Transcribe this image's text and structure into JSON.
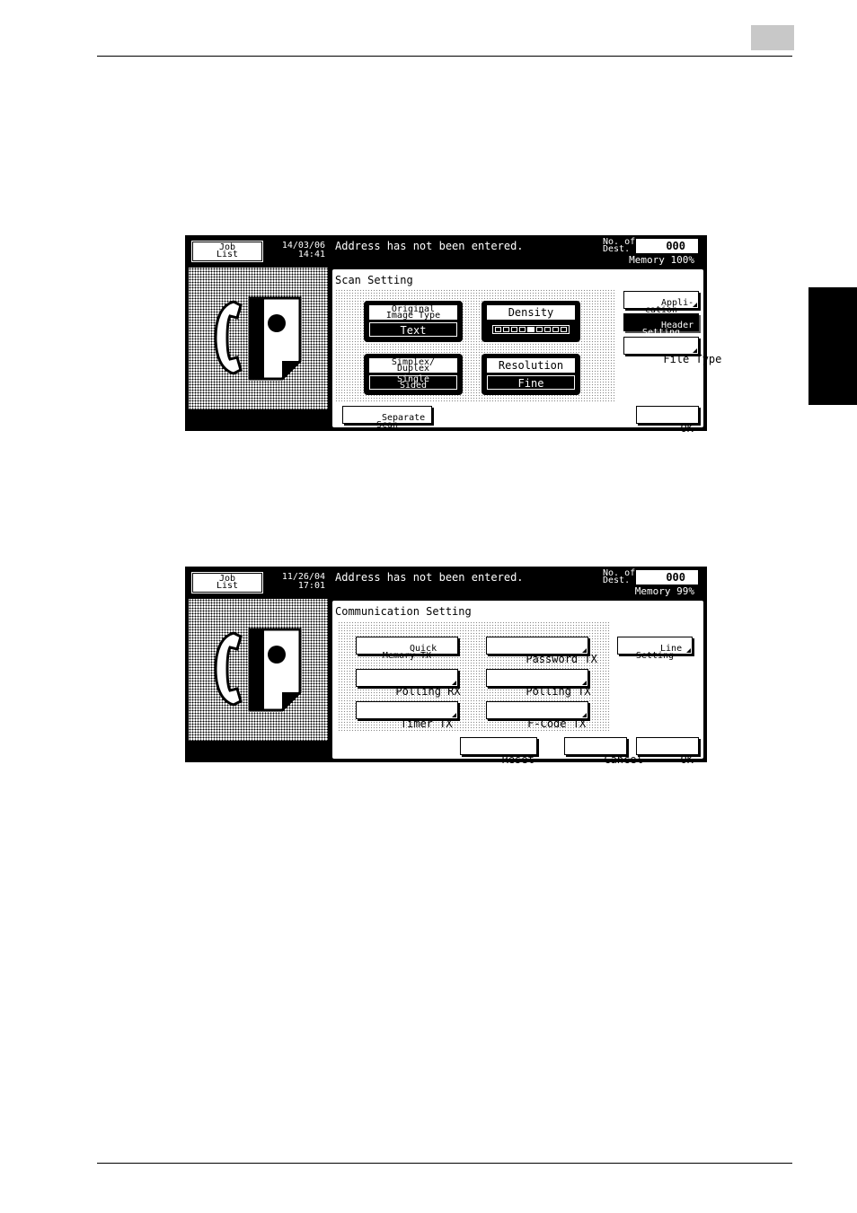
{
  "screen1": {
    "job_list_label": "Job\nList",
    "datetime": "14/03/06\n14:41",
    "message": "Address has not been entered.",
    "dest_label": "No. of\nDest.",
    "dest_count": "000",
    "memory": "Memory 100%",
    "panel_title": "Scan Setting",
    "original_image_type_label": "Original\nImage Type",
    "original_image_type_value": "Text",
    "density_label": "Density",
    "density_level": 0.5,
    "simplex_duplex_label": "Simplex/\nDuplex",
    "simplex_duplex_value": "Single\nSided",
    "resolution_label": "Resolution",
    "resolution_value": "Fine",
    "application_label": "Appli-\ncation",
    "header_setting_label": "Header\nSetting",
    "file_type_label": "File Type",
    "separate_scan_label": "Separate\nScan",
    "ok_label": "OK"
  },
  "screen2": {
    "job_list_label": "Job\nList",
    "datetime": "11/26/04\n17:01",
    "message": "Address has not been entered.",
    "dest_label": "No. of\nDest.",
    "dest_count": "000",
    "memory": "Memory 99%",
    "panel_title": "Communication Setting",
    "quick_memory_tx_label": "Quick\nMemory TX",
    "password_tx_label": "Password TX",
    "line_setting_label": "Line\nSetting",
    "polling_rx_label": "Polling RX",
    "polling_tx_label": "Polling TX",
    "timer_tx_label": "Timer TX",
    "fcode_tx_label": "F-Code TX",
    "reset_label": "Reset",
    "cancel_label": "Cancel",
    "ok_label": "OK"
  },
  "icons": [
    "fax-handset-icon",
    "fax-document-icon"
  ],
  "colors": {
    "screen_bg": "#000000",
    "panel_bg": "#ffffff",
    "chapter_box": "#c8c8c8"
  }
}
